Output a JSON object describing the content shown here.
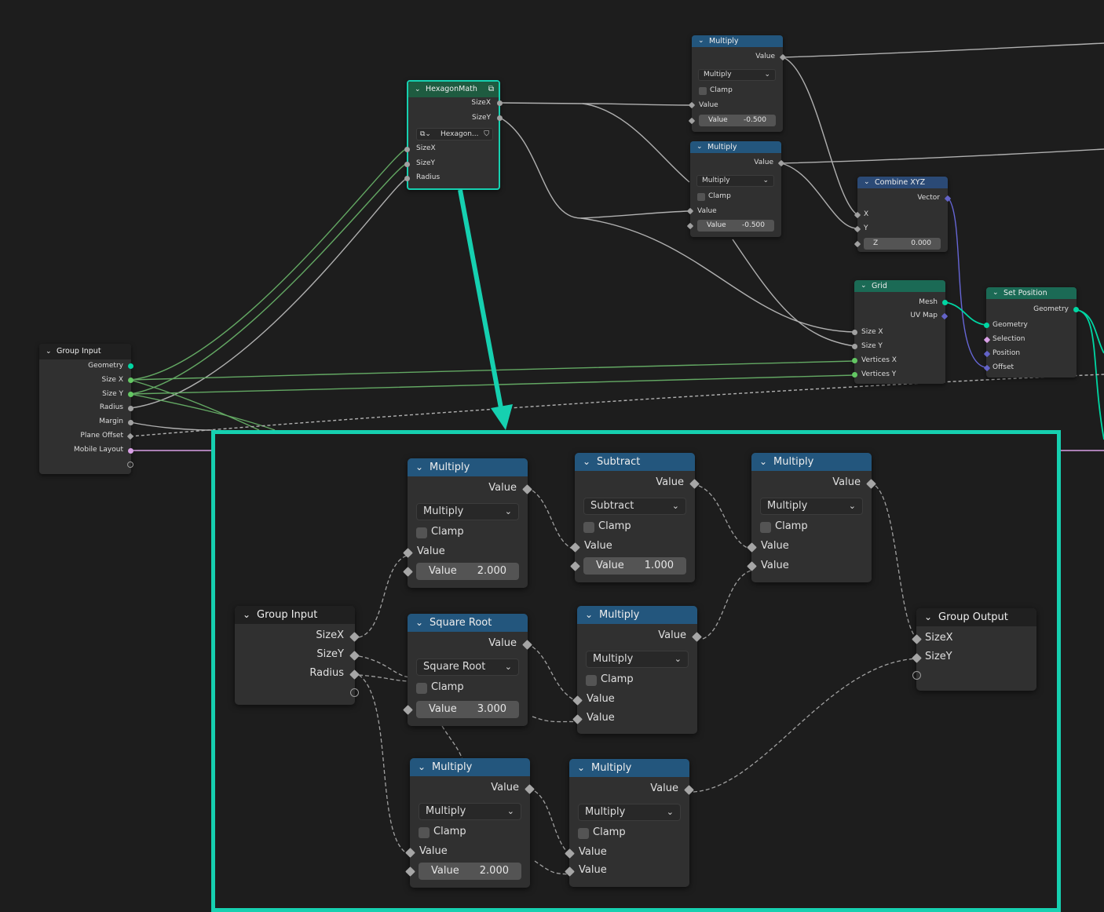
{
  "colors": {
    "accent": "#16d0b0",
    "math_header": "#23567d",
    "geometry_header": "#1b6a55",
    "vector_header": "#2b4a76"
  },
  "bg_nodes": {
    "group_input": {
      "title": "Group Input",
      "outputs": [
        "Geometry",
        "Size X",
        "Size Y",
        "Radius",
        "Margin",
        "Plane Offset",
        "Mobile Layout"
      ]
    },
    "hexagon_math": {
      "title": "HexagonMath",
      "outputs": [
        "SizeX",
        "SizeY"
      ],
      "datablock": "Hexagon...",
      "inputs": [
        "SizeX",
        "SizeY",
        "Radius"
      ]
    },
    "multiply_a": {
      "title": "Multiply",
      "output": "Value",
      "op": "Multiply",
      "clamp": "Clamp",
      "input": "Value",
      "field_label": "Value",
      "field_value": "-0.500"
    },
    "multiply_b": {
      "title": "Multiply",
      "output": "Value",
      "op": "Multiply",
      "clamp": "Clamp",
      "input": "Value",
      "field_label": "Value",
      "field_value": "-0.500"
    },
    "combine_xyz": {
      "title": "Combine XYZ",
      "output": "Vector",
      "inputs": [
        "X",
        "Y"
      ],
      "z_label": "Z",
      "z_value": "0.000"
    },
    "grid": {
      "title": "Grid",
      "outputs": [
        "Mesh",
        "UV Map"
      ],
      "inputs": [
        "Size X",
        "Size Y",
        "Vertices X",
        "Vertices Y"
      ]
    },
    "set_position": {
      "title": "Set Position",
      "output": "Geometry",
      "inputs": [
        "Geometry",
        "Selection",
        "Position",
        "Offset"
      ]
    }
  },
  "inset": {
    "group_input": {
      "title": "Group Input",
      "outputs": [
        "SizeX",
        "SizeY",
        "Radius"
      ]
    },
    "multiply1": {
      "title": "Multiply",
      "output": "Value",
      "op": "Multiply",
      "clamp": "Clamp",
      "input": "Value",
      "field_label": "Value",
      "field_value": "2.000"
    },
    "subtract": {
      "title": "Subtract",
      "output": "Value",
      "op": "Subtract",
      "clamp": "Clamp",
      "input": "Value",
      "field_label": "Value",
      "field_value": "1.000"
    },
    "multiply2": {
      "title": "Multiply",
      "output": "Value",
      "op": "Multiply",
      "clamp": "Clamp",
      "inputs": [
        "Value",
        "Value"
      ]
    },
    "sqrt": {
      "title": "Square Root",
      "output": "Value",
      "op": "Square Root",
      "clamp": "Clamp",
      "field_label": "Value",
      "field_value": "3.000"
    },
    "multiply3": {
      "title": "Multiply",
      "output": "Value",
      "op": "Multiply",
      "clamp": "Clamp",
      "inputs": [
        "Value",
        "Value"
      ]
    },
    "multiply4": {
      "title": "Multiply",
      "output": "Value",
      "op": "Multiply",
      "clamp": "Clamp",
      "input": "Value",
      "field_label": "Value",
      "field_value": "2.000"
    },
    "multiply5": {
      "title": "Multiply",
      "output": "Value",
      "op": "Multiply",
      "clamp": "Clamp",
      "inputs": [
        "Value",
        "Value"
      ]
    },
    "group_output": {
      "title": "Group Output",
      "inputs": [
        "SizeX",
        "SizeY"
      ]
    }
  }
}
